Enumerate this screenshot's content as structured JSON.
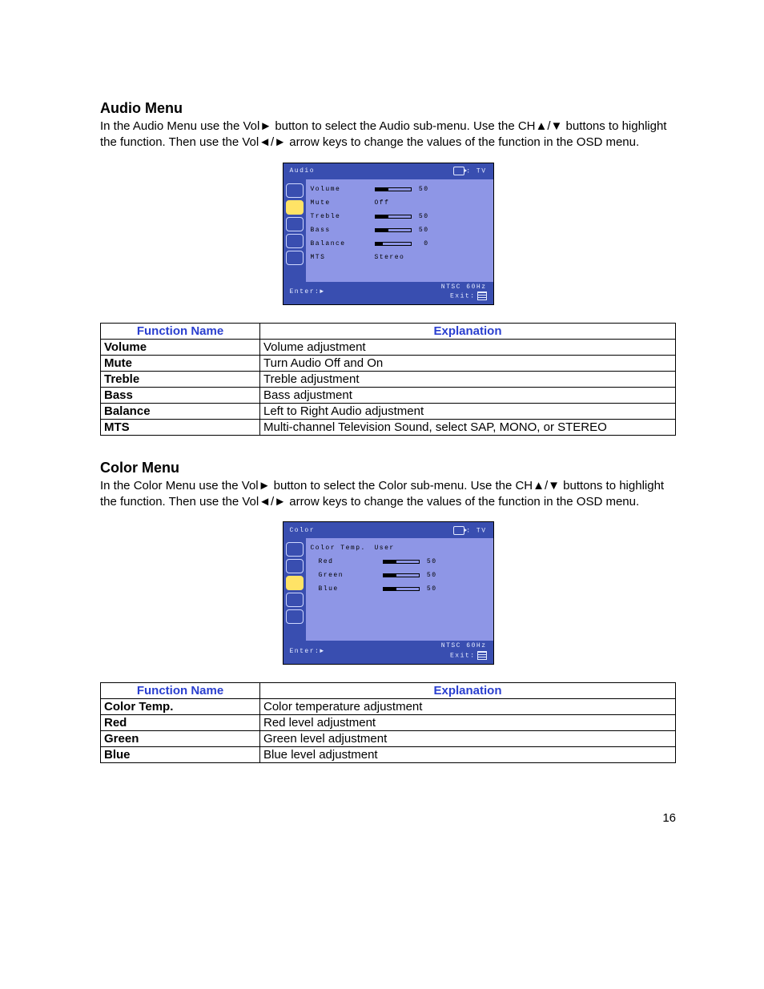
{
  "page_number": "16",
  "sections": {
    "audio": {
      "heading": "Audio Menu",
      "desc": "In the Audio Menu use the Vol► button to select the Audio sub-menu. Use the CH▲/▼ buttons to highlight the function.    Then use the Vol◄/► arrow keys to change the values of the function in the OSD menu.",
      "osd": {
        "title": "Audio",
        "input_label": ": TV",
        "footer_left": "Enter:►",
        "footer_right_top": "NTSC 60Hz",
        "footer_right_bottom": "Exit:",
        "icons_count": 5,
        "selected_icon_index": 1,
        "rows": [
          {
            "label": "Volume",
            "type": "slider",
            "fill": 38,
            "value": "50"
          },
          {
            "label": "Mute",
            "type": "text",
            "text": "Off"
          },
          {
            "label": "Treble",
            "type": "slider",
            "fill": 38,
            "value": "50"
          },
          {
            "label": "Bass",
            "type": "slider",
            "fill": 38,
            "value": "50"
          },
          {
            "label": "Balance",
            "type": "slider",
            "fill": 22,
            "value": "0"
          },
          {
            "label": "MTS",
            "type": "text",
            "text": "Stereo"
          }
        ]
      },
      "table": {
        "headers": {
          "fn": "Function Name",
          "ex": "Explanation"
        },
        "rows": [
          {
            "name": "Volume",
            "explanation": "Volume adjustment"
          },
          {
            "name": "Mute",
            "explanation": "Turn Audio Off and On"
          },
          {
            "name": "Treble",
            "explanation": "Treble adjustment"
          },
          {
            "name": "Bass",
            "explanation": "Bass adjustment"
          },
          {
            "name": "Balance",
            "explanation": "Left to Right Audio adjustment"
          },
          {
            "name": "MTS",
            "explanation": "Multi-channel Television Sound, select SAP, MONO, or STEREO"
          }
        ]
      }
    },
    "color": {
      "heading": "Color Menu",
      "desc": "In the Color Menu use the Vol► button to select the Color sub-menu. Use the CH▲/▼ buttons to highlight the function.    Then use the Vol◄/► arrow keys to change the values of the function in the OSD menu.",
      "osd": {
        "title": "Color",
        "input_label": ": TV",
        "footer_left": "Enter:►",
        "footer_right_top": "NTSC 60Hz",
        "footer_right_bottom": "Exit:",
        "icons_count": 5,
        "selected_icon_index": 2,
        "rows": [
          {
            "label": "Color Temp.",
            "type": "text",
            "text": "User",
            "indent": false
          },
          {
            "label": "Red",
            "type": "slider",
            "fill": 38,
            "value": "50",
            "indent": true
          },
          {
            "label": "Green",
            "type": "slider",
            "fill": 38,
            "value": "50",
            "indent": true
          },
          {
            "label": "Blue",
            "type": "slider",
            "fill": 38,
            "value": "50",
            "indent": true
          }
        ]
      },
      "table": {
        "headers": {
          "fn": "Function Name",
          "ex": "Explanation"
        },
        "rows": [
          {
            "name": "Color Temp.",
            "explanation": "Color temperature adjustment"
          },
          {
            "name": "Red",
            "explanation": "Red level adjustment"
          },
          {
            "name": "Green",
            "explanation": "Green level adjustment"
          },
          {
            "name": "Blue",
            "explanation": "Blue level adjustment"
          }
        ]
      }
    }
  }
}
